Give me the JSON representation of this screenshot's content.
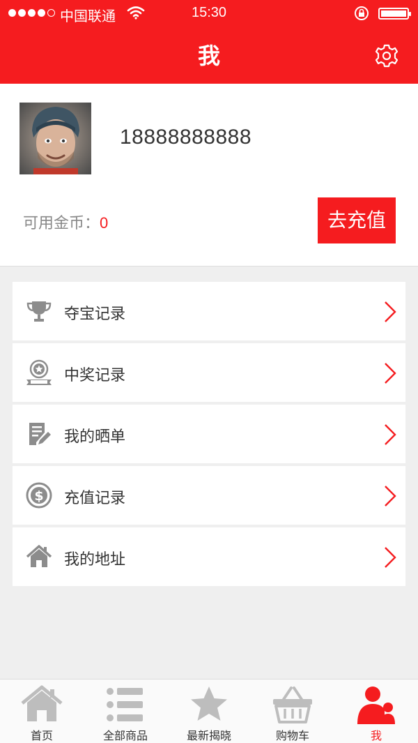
{
  "status_bar": {
    "carrier": "中国联通",
    "time": "15:30"
  },
  "header": {
    "title": "我",
    "settings_icon": "gear-icon"
  },
  "profile": {
    "phone": "18888888888",
    "coins_label": "可用金币：",
    "coins_value": "0",
    "recharge_label": "去充值"
  },
  "menu": {
    "items": [
      {
        "label": "夺宝记录",
        "icon": "trophy-icon"
      },
      {
        "label": "中奖记录",
        "icon": "award-badge-icon"
      },
      {
        "label": "我的晒单",
        "icon": "edit-document-icon"
      },
      {
        "label": "充值记录",
        "icon": "dollar-circle-icon"
      },
      {
        "label": "我的地址",
        "icon": "home-icon"
      }
    ]
  },
  "tabbar": {
    "tabs": [
      {
        "label": "首页",
        "icon": "home-icon"
      },
      {
        "label": "全部商品",
        "icon": "list-icon"
      },
      {
        "label": "最新揭晓",
        "icon": "star-icon"
      },
      {
        "label": "购物车",
        "icon": "basket-icon"
      },
      {
        "label": "我",
        "icon": "user-icon",
        "active": true
      }
    ]
  },
  "colors": {
    "accent": "#f51c1f",
    "icon_gray": "#8c8c8c",
    "background": "#efefef"
  }
}
